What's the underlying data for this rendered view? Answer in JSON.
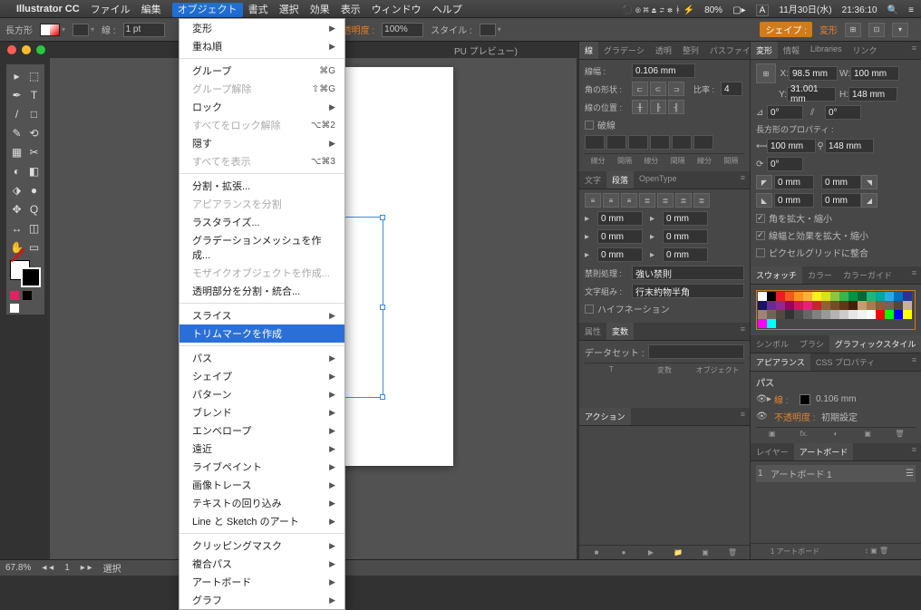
{
  "menubar": {
    "app": "Illustrator CC",
    "items": [
      "ファイル",
      "編集",
      "オブジェクト",
      "書式",
      "選択",
      "効果",
      "表示",
      "ウィンドウ",
      "ヘルプ"
    ],
    "active_index": 2,
    "right": {
      "battery": "80%",
      "ime": "A",
      "date": "11月30日(水)",
      "time": "21:36:10"
    }
  },
  "controlbar": {
    "shape": "長方形",
    "stroke_label": "線 :",
    "stroke_pt": "1 pt",
    "opacity_label": "不透明度 :",
    "opacity": "100%",
    "style_label": "スタイル :",
    "shape_btn": "シェイプ :",
    "transform_btn": "変形"
  },
  "window_title": "PU プレビュー)",
  "dropdown": {
    "groups": [
      {
        "items": [
          {
            "t": "変形",
            "arrow": true
          },
          {
            "t": "重ね順",
            "arrow": true
          }
        ]
      },
      {
        "items": [
          {
            "t": "グループ",
            "short": "⌘G"
          },
          {
            "t": "グループ解除",
            "short": "⇧⌘G",
            "dis": true
          },
          {
            "t": "ロック",
            "arrow": true
          },
          {
            "t": "すべてをロック解除",
            "short": "⌥⌘2",
            "dis": true
          },
          {
            "t": "隠す",
            "arrow": true
          },
          {
            "t": "すべてを表示",
            "short": "⌥⌘3",
            "dis": true
          }
        ]
      },
      {
        "items": [
          {
            "t": "分割・拡張..."
          },
          {
            "t": "アピアランスを分割",
            "dis": true
          },
          {
            "t": "ラスタライズ..."
          },
          {
            "t": "グラデーションメッシュを作成..."
          },
          {
            "t": "モザイクオブジェクトを作成...",
            "dis": true
          },
          {
            "t": "透明部分を分割・統合..."
          }
        ]
      },
      {
        "items": [
          {
            "t": "スライス",
            "arrow": true
          },
          {
            "t": "トリムマークを作成",
            "hl": true
          }
        ]
      },
      {
        "items": [
          {
            "t": "パス",
            "arrow": true
          },
          {
            "t": "シェイプ",
            "arrow": true
          },
          {
            "t": "パターン",
            "arrow": true
          },
          {
            "t": "ブレンド",
            "arrow": true
          },
          {
            "t": "エンベロープ",
            "arrow": true
          },
          {
            "t": "遠近",
            "arrow": true
          },
          {
            "t": "ライブペイント",
            "arrow": true
          },
          {
            "t": "画像トレース",
            "arrow": true
          },
          {
            "t": "テキストの回り込み",
            "arrow": true
          },
          {
            "t": "Line と Sketch のアート",
            "arrow": true
          }
        ]
      },
      {
        "items": [
          {
            "t": "クリッピングマスク",
            "arrow": true
          },
          {
            "t": "複合パス",
            "arrow": true
          },
          {
            "t": "アートボード",
            "arrow": true
          },
          {
            "t": "グラフ",
            "arrow": true
          }
        ]
      }
    ]
  },
  "tools": [
    "▸",
    "⬚",
    "✒",
    "T",
    "/",
    "□",
    "✎",
    "⟲",
    "▦",
    "✂",
    "◐",
    "◧",
    "⬗",
    "●",
    "✥",
    "Q",
    "↔",
    "◫",
    "✋",
    "▭"
  ],
  "left_panel": {
    "tabs1": [
      "線",
      "グラデーシ",
      "透明",
      "整列",
      "パスファイ"
    ],
    "stroke_width_label": "線幅 :",
    "stroke_width": "0.106 mm",
    "cap_label": "角の形状 :",
    "ratio_label": "比率 :",
    "ratio": "4",
    "pos_label": "線の位置 :",
    "dash_label": "破線",
    "dash_cols": [
      "線分",
      "間隔",
      "線分",
      "間隔",
      "線分",
      "間隔"
    ],
    "tabs2": [
      "文字",
      "段落",
      "OpenType"
    ],
    "row_fields": [
      "0 mm",
      "0 mm",
      "0 mm",
      "0 mm",
      "0 mm",
      "0 mm"
    ],
    "kinsoku_label": "禁則処理 :",
    "kinsoku": "強い禁則",
    "mojikumi_label": "文字組み :",
    "mojikumi": "行末約物半角",
    "hyphen": "ハイフネーション",
    "tabs3": [
      "属性",
      "変数"
    ],
    "dataset_label": "データセット :",
    "varcols": [
      "T",
      "変数",
      "オブジェクト"
    ],
    "actions_tab": "アクション"
  },
  "right_panel": {
    "tabs1": [
      "変形",
      "情報",
      "Libraries",
      "リンク"
    ],
    "x": "98.5 mm",
    "y": "31.001 mm",
    "w": "100 mm",
    "h": "148 mm",
    "angle": "0°",
    "shear": "0°",
    "radii": [
      "0 mm",
      "0 mm",
      "0 mm",
      "0 mm"
    ],
    "props_label": "長方形のプロパティ :",
    "pw": "100 mm",
    "ph": "148 mm",
    "chk1": "角を拡大・縮小",
    "chk2": "線幅と効果を拡大・縮小",
    "chk3": "ピクセルグリッドに整合",
    "tabs2": [
      "スウォッチ",
      "カラー",
      "カラーガイド"
    ],
    "tabs3": [
      "シンボル",
      "ブラシ",
      "グラフィックスタイル"
    ],
    "tabs4": [
      "アピアランス",
      "CSS プロパティ"
    ],
    "ap_path": "パス",
    "ap_stroke": "線 :",
    "ap_stroke_val": "0.106 mm",
    "ap_opacity": "不透明度 :",
    "ap_opacity_val": "初期設定",
    "tabs5": [
      "レイヤー",
      "アートボード"
    ],
    "artboard": "アートボード 1",
    "artboard_count": "1 アートボード"
  },
  "status": {
    "zoom": "67.8%",
    "page": "1",
    "mode": "選択"
  },
  "swatch_colors": [
    "#ffffff",
    "#000000",
    "#ed1c24",
    "#f15a24",
    "#f7931e",
    "#fbb03b",
    "#fcee21",
    "#d9e021",
    "#8cc63f",
    "#39b54a",
    "#009245",
    "#006837",
    "#22b573",
    "#00a99d",
    "#29abe2",
    "#0071bc",
    "#2e3192",
    "#1b1464",
    "#662d91",
    "#93278f",
    "#9e005d",
    "#d4145a",
    "#ed1e79",
    "#c1272d",
    "#8c6239",
    "#754c24",
    "#603813",
    "#42210b",
    "#c69c6d",
    "#a67c52",
    "#8b5e3c",
    "#736357",
    "#534741",
    "#c7b299",
    "#998675",
    "#736357",
    "#534741",
    "#333333",
    "#4d4d4d",
    "#666666",
    "#808080",
    "#999999",
    "#b3b3b3",
    "#cccccc",
    "#e6e6e6",
    "#f2f2f2",
    "#ffffff",
    "#ff0000",
    "#00ff00",
    "#0000ff",
    "#ffff00",
    "#ff00ff",
    "#00ffff"
  ]
}
